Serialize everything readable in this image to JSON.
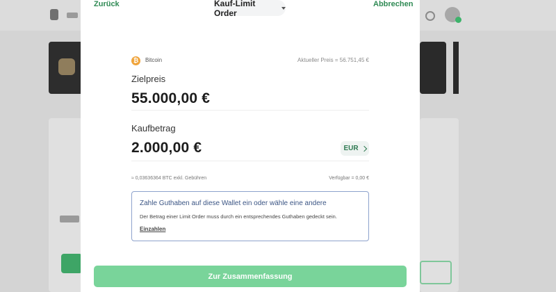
{
  "header": {
    "back_label": "Zurück",
    "order_type_label": "Kauf-Limit Order",
    "cancel_label": "Abbrechen"
  },
  "asset": {
    "name": "Bitcoin",
    "icon_symbol": "₿",
    "current_price_label": "Aktueller Preis = 56.751,45 €"
  },
  "target_price": {
    "label": "Zielpreis",
    "value": "55.000,00 €"
  },
  "buy_amount": {
    "label": "Kaufbetrag",
    "value": "2.000,00 €",
    "currency": "EUR"
  },
  "info": {
    "btc_estimate": "≈ 0,03636364 BTC exkl. Gebühren",
    "available": "Verfügbar = 0,00 €"
  },
  "wallet_notice": {
    "title": "Zahle Guthaben auf diese Wallet ein oder wähle eine andere",
    "text": "Der Betrag einer Limit Order muss durch ein entsprechendes Guthaben gedeckt sein.",
    "link": "Einzahlen"
  },
  "summary_button_label": "Zur Zusammenfassung",
  "colors": {
    "accent_green": "#2f8a54",
    "button_green": "#79d49a",
    "bitcoin_orange": "#f0a43b",
    "notice_border": "#8da2cc"
  },
  "icons": {
    "caret": "chevron-down-icon",
    "currency_arrow": "chevron-right-icon",
    "asset": "bitcoin-icon"
  }
}
